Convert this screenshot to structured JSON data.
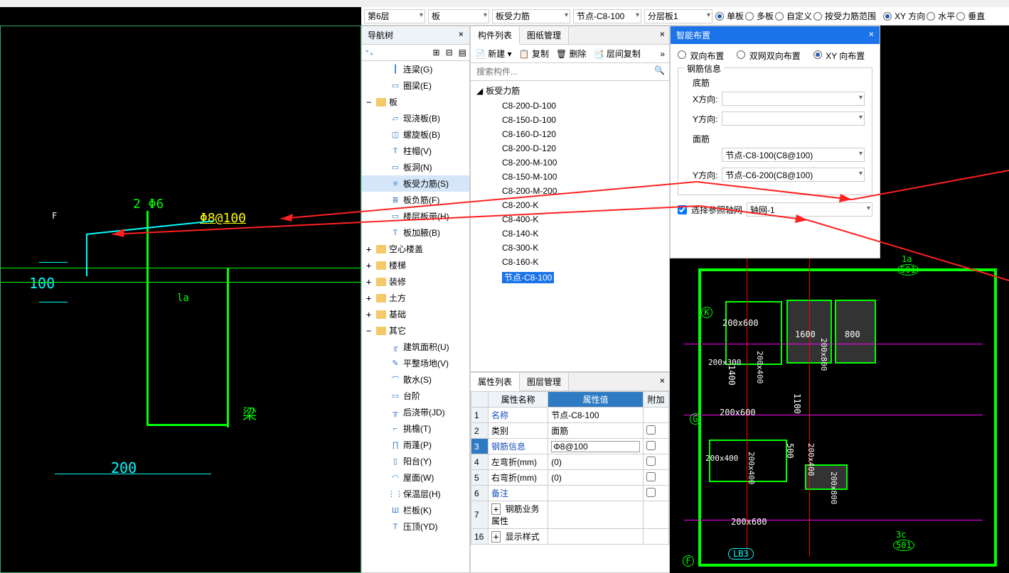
{
  "topbar": {
    "floor": "第6层",
    "category": "板",
    "subtype": "板受力筋",
    "node": "节点-C8-100",
    "layer": "分层板1",
    "radios_a": {
      "single": "单板",
      "multi": "多板",
      "custom": "自定义",
      "byrange": "按受力筋范围"
    },
    "radios_b": {
      "xy": "XY 方向",
      "hor": "水平",
      "ver": "垂直"
    }
  },
  "nav": {
    "title": "导航树",
    "items": [
      {
        "lvl": 2,
        "icon": "┃",
        "label": "连梁(G)"
      },
      {
        "lvl": 2,
        "icon": "▭",
        "label": "圈梁(E)"
      },
      {
        "lvl": 0,
        "folder": true,
        "exp": "−",
        "label": "板"
      },
      {
        "lvl": 2,
        "icon": "▱",
        "label": "现浇板(B)"
      },
      {
        "lvl": 2,
        "icon": "◫",
        "label": "螺旋板(B)"
      },
      {
        "lvl": 2,
        "icon": "T",
        "label": "柱帽(V)"
      },
      {
        "lvl": 2,
        "icon": "▭",
        "label": "板洞(N)"
      },
      {
        "lvl": 2,
        "icon": "≡",
        "label": "板受力筋(S)",
        "sel": true
      },
      {
        "lvl": 2,
        "icon": "≣",
        "label": "板负筋(F)"
      },
      {
        "lvl": 2,
        "icon": "▭",
        "label": "楼层板带(H)"
      },
      {
        "lvl": 2,
        "icon": "T",
        "label": "板加腋(B)"
      },
      {
        "lvl": 0,
        "folder": true,
        "exp": "+",
        "label": "空心楼盖"
      },
      {
        "lvl": 0,
        "folder": true,
        "exp": "+",
        "label": "楼梯"
      },
      {
        "lvl": 0,
        "folder": true,
        "exp": "+",
        "label": "装修"
      },
      {
        "lvl": 0,
        "folder": true,
        "exp": "+",
        "label": "土方"
      },
      {
        "lvl": 0,
        "folder": true,
        "exp": "+",
        "label": "基础"
      },
      {
        "lvl": 0,
        "folder": true,
        "exp": "−",
        "label": "其它"
      },
      {
        "lvl": 2,
        "icon": "╓",
        "label": "建筑面积(U)"
      },
      {
        "lvl": 2,
        "icon": "✎",
        "label": "平整场地(V)"
      },
      {
        "lvl": 2,
        "icon": "⌒",
        "label": "散水(S)"
      },
      {
        "lvl": 2,
        "icon": "▭",
        "label": "台阶"
      },
      {
        "lvl": 2,
        "icon": "╥",
        "label": "后浇带(JD)"
      },
      {
        "lvl": 2,
        "icon": "⌐",
        "label": "挑檐(T)"
      },
      {
        "lvl": 2,
        "icon": "∏",
        "label": "雨蓬(P)"
      },
      {
        "lvl": 2,
        "icon": "▯",
        "label": "阳台(Y)"
      },
      {
        "lvl": 2,
        "icon": "◠",
        "label": "屋面(W)"
      },
      {
        "lvl": 2,
        "icon": "⋮⋮",
        "label": "保温层(H)"
      },
      {
        "lvl": 2,
        "icon": "Ш",
        "label": "栏板(K)"
      },
      {
        "lvl": 2,
        "icon": "T",
        "label": "压顶(YD)"
      }
    ]
  },
  "comp": {
    "tab_list": "构件列表",
    "tab_layer": "图纸管理",
    "btn_new": "新建",
    "btn_copy": "复制",
    "btn_del": "删除",
    "btn_flcopy": "层间复制",
    "search_ph": "搜索构件...",
    "group": "板受力筋",
    "items": [
      "C8-200-D-100",
      "C8-150-D-100",
      "C8-160-D-120",
      "C8-200-D-120",
      "C8-200-M-100",
      "C8-150-M-100",
      "C8-200-M-200",
      "C8-200-K",
      "C8-400-K",
      "C8-140-K",
      "C8-300-K",
      "C8-160-K",
      "节点-C8-100"
    ],
    "selected": "节点-C8-100"
  },
  "smart": {
    "title": "智能布置",
    "radios": {
      "dx": "双向布置",
      "dwsx": "双网双向布置",
      "xy": "XY 向布置"
    },
    "fs_steel": "钢筋信息",
    "fs_bottom": "底筋",
    "fs_top": "面筋",
    "xdir": "X方向:",
    "ydir": "Y方向:",
    "top_x_val": "节点-C8-100(C8@100)",
    "top_y_val": "节点-C6-200(C8@100)",
    "check_label": "选择参照轴网",
    "grid_val": "轴网-1"
  },
  "prop": {
    "tab_attr": "属性列表",
    "tab_layer": "图层管理",
    "col_name": "属性名称",
    "col_val": "属性值",
    "col_extra": "附加",
    "rows": [
      {
        "n": "1",
        "name": "名称",
        "val": "节点-C8-100",
        "blue": true
      },
      {
        "n": "2",
        "name": "类别",
        "val": "面筋"
      },
      {
        "n": "3",
        "name": "钢筋信息",
        "val": "Φ8@100",
        "blue": true,
        "editing": true,
        "active": true
      },
      {
        "n": "4",
        "name": "左弯折(mm)",
        "val": "(0)"
      },
      {
        "n": "5",
        "name": "右弯折(mm)",
        "val": "(0)"
      },
      {
        "n": "6",
        "name": "备注",
        "val": "",
        "blue": true
      },
      {
        "n": "7",
        "name": "钢筋业务属性",
        "val": "",
        "exp": "+"
      },
      {
        "n": "16",
        "name": "显示样式",
        "val": "",
        "exp": "+"
      }
    ]
  },
  "cad_left": {
    "t1": "2 Φ6",
    "t2": "Φ8@100",
    "t3": "la",
    "t4": "梁",
    "d_F": "F",
    "d_100": "100",
    "d_200": "200"
  },
  "cad_right": {
    "dims": [
      "200x600",
      "1600",
      "800",
      "200x300",
      "200x400",
      "200x600",
      "1400",
      "1100",
      "200x400",
      "200x400",
      "500",
      "200x400",
      "200x600",
      "200x800",
      "200x800"
    ],
    "labels": {
      "G": "G",
      "K": "K",
      "F": "F",
      "la": "1a",
      "n501": "501",
      "c3": "3c",
      "LB3": "LB3"
    }
  }
}
